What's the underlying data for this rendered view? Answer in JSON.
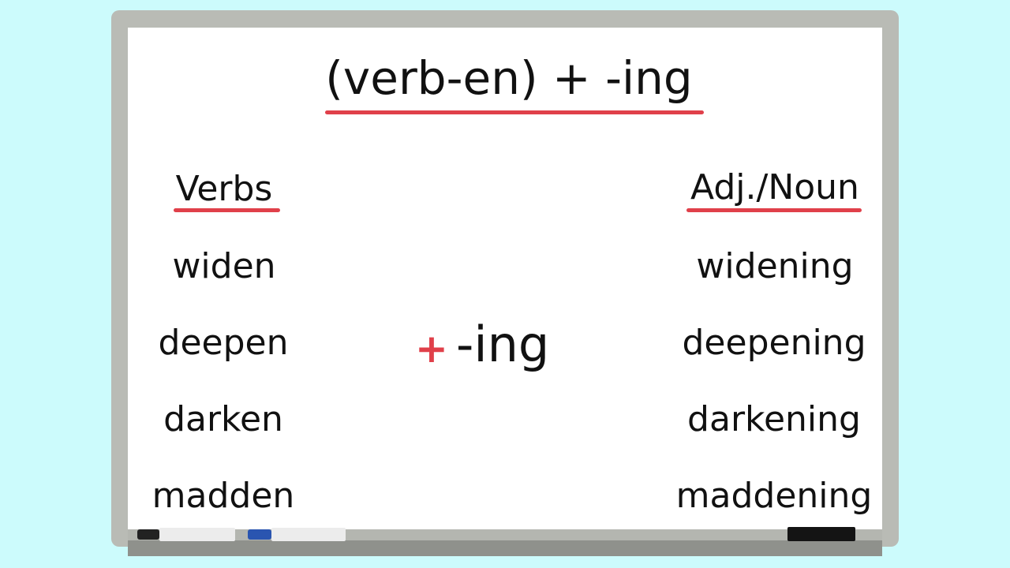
{
  "title": "(verb-en) + -ing",
  "columns": {
    "left_header": "Verbs",
    "right_header": "Adj./Noun"
  },
  "middle": {
    "plus": "+",
    "suffix": "-ing"
  },
  "verbs": [
    "widen",
    "deepen",
    "darken",
    "madden"
  ],
  "forms": [
    "widening",
    "deepening",
    "darkening",
    "maddening"
  ],
  "colors": {
    "background": "#ccfbfc",
    "board": "#ffffff",
    "frame": "#b9bbb5",
    "accent": "#e0404a",
    "marker_black": "#222222",
    "marker_blue": "#2a55b0",
    "eraser": "#141414"
  },
  "icons": [
    "black-marker-icon",
    "blue-marker-icon",
    "eraser-icon"
  ]
}
